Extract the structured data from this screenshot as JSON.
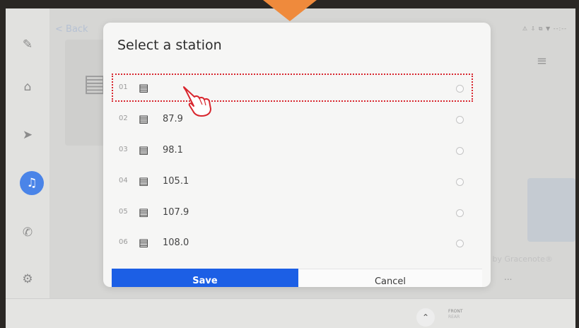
{
  "background": {
    "back_label": "< Back",
    "status_text": "⚠ ⇩ ⧉ ▼   --:--",
    "attribution": "d by Gracenote®",
    "more_label": "...",
    "front_label": "FRONT",
    "front_sublabel": "REAR"
  },
  "rail": [
    {
      "name": "settings-wrench-icon",
      "glyph": "✎"
    },
    {
      "name": "home-icon",
      "glyph": "⌂"
    },
    {
      "name": "navigation-icon",
      "glyph": "➤"
    },
    {
      "name": "music-icon",
      "glyph": "♫",
      "active": true
    },
    {
      "name": "phone-icon",
      "glyph": "✆"
    },
    {
      "name": "gear-icon",
      "glyph": "⚙"
    }
  ],
  "modal": {
    "title": "Select a station",
    "stations": [
      {
        "num": "01",
        "freq": ""
      },
      {
        "num": "02",
        "freq": "87.9"
      },
      {
        "num": "03",
        "freq": "98.1"
      },
      {
        "num": "04",
        "freq": "105.1"
      },
      {
        "num": "05",
        "freq": "107.9"
      },
      {
        "num": "06",
        "freq": "108.0"
      }
    ],
    "save_label": "Save",
    "cancel_label": "Cancel"
  },
  "colors": {
    "accent": "#1c5fe5",
    "annotation_arrow": "#ef8a3c",
    "highlight_border": "#d8262e"
  }
}
